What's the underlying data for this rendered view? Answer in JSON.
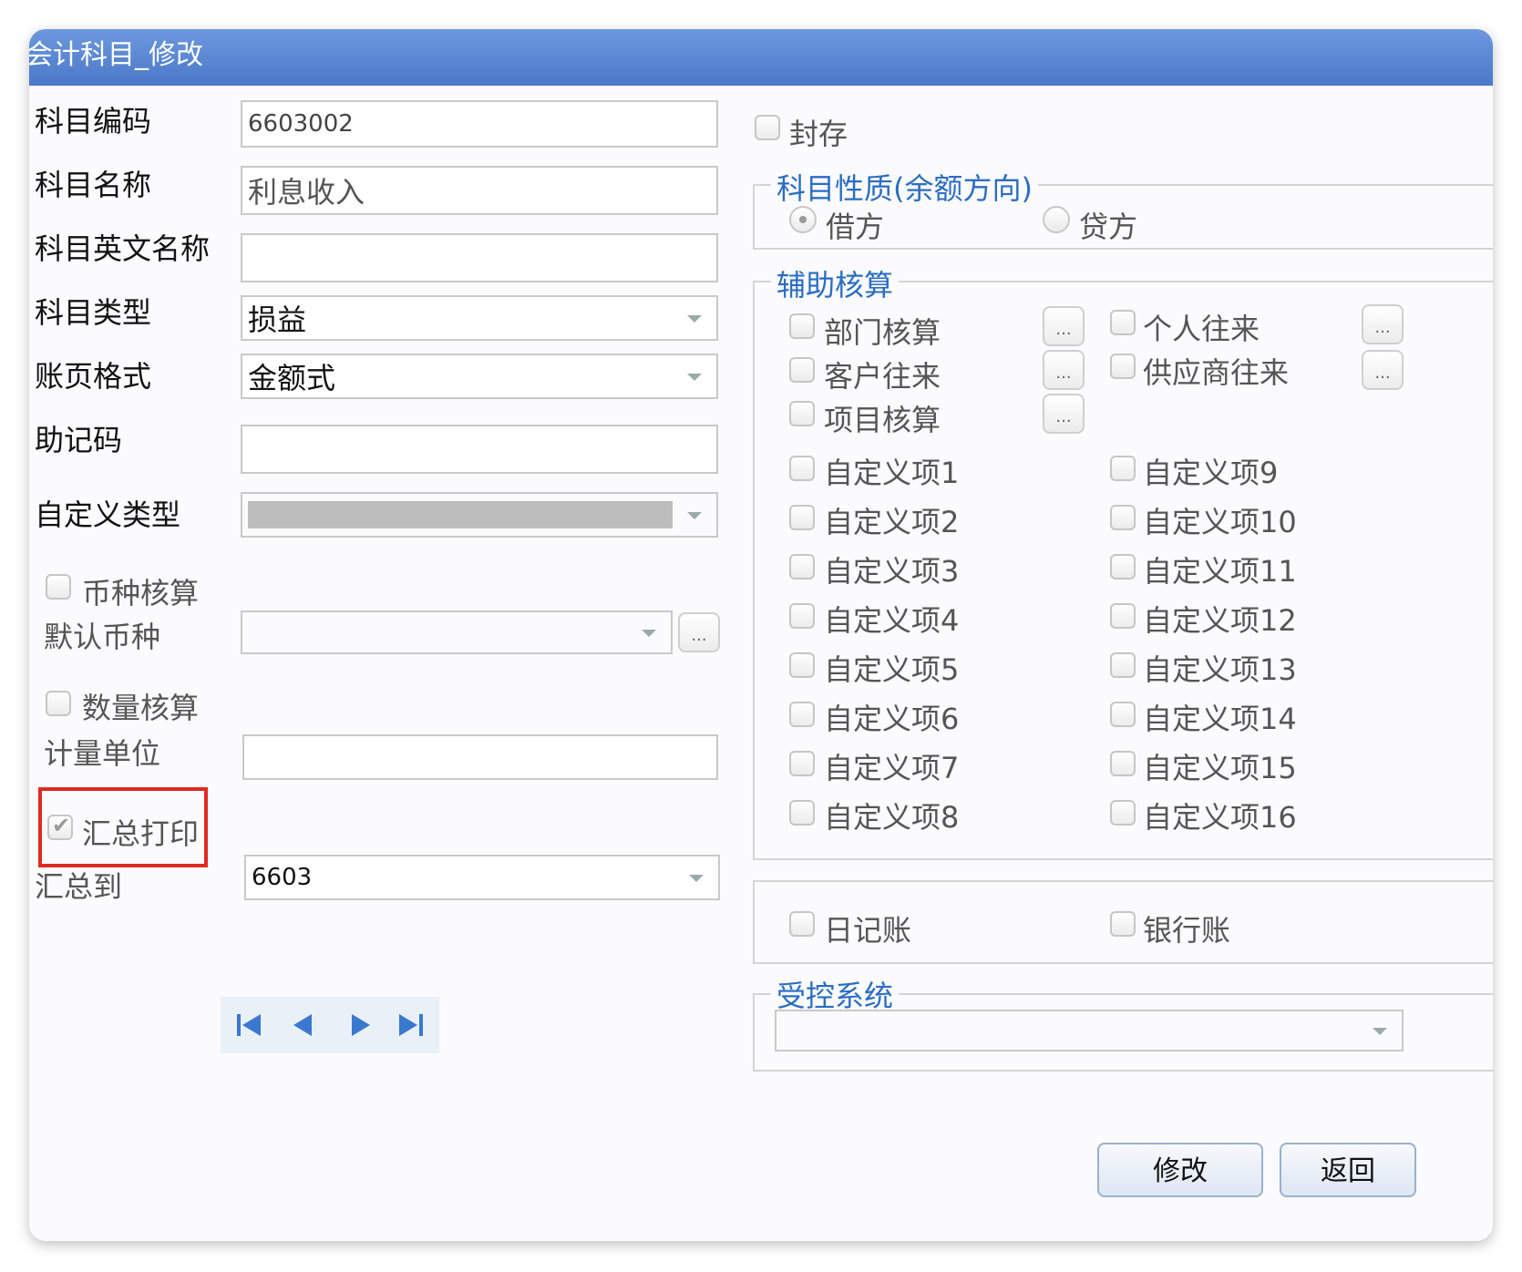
{
  "window": {
    "title": "会计科目_修改"
  },
  "form": {
    "code_label": "科目编码",
    "code_value": "6603002",
    "name_label": "科目名称",
    "name_value": "利息收入",
    "en_name_label": "科目英文名称",
    "en_name_value": "",
    "type_label": "科目类型",
    "type_value": "损益",
    "format_label": "账页格式",
    "format_value": "金额式",
    "mnemonic_label": "助记码",
    "mnemonic_value": "",
    "custom_type_label": "自定义类型",
    "currency_check_label": "币种核算",
    "default_currency_label": "默认币种",
    "quantity_check_label": "数量核算",
    "unit_label": "计量单位",
    "unit_value": "",
    "summary_print_label": "汇总打印",
    "summary_to_label": "汇总到",
    "summary_to_value": "6603"
  },
  "right": {
    "sealed_label": "封存",
    "nature_group_title": "科目性质(余额方向)",
    "debit_label": "借方",
    "credit_label": "贷方",
    "aux_group_title": "辅助核算",
    "dept_label": "部门核算",
    "personal_label": "个人往来",
    "customer_label": "客户往来",
    "supplier_label": "供应商往来",
    "project_label": "项目核算",
    "dots_label": "...",
    "custom_items_left": [
      "自定义项1",
      "自定义项2",
      "自定义项3",
      "自定义项4",
      "自定义项5",
      "自定义项6",
      "自定义项7",
      "自定义项8"
    ],
    "custom_items_right": [
      "自定义项9",
      "自定义项10",
      "自定义项11",
      "自定义项12",
      "自定义项13",
      "自定义项14",
      "自定义项15",
      "自定义项16"
    ],
    "journal_label": "日记账",
    "bank_label": "银行账",
    "controlled_group_title": "受控系统"
  },
  "buttons": {
    "modify": "修改",
    "back": "返回"
  },
  "colors": {
    "title_bar": "#5485d2",
    "group_title": "#2b6cc4",
    "highlight": "#e02a20"
  }
}
